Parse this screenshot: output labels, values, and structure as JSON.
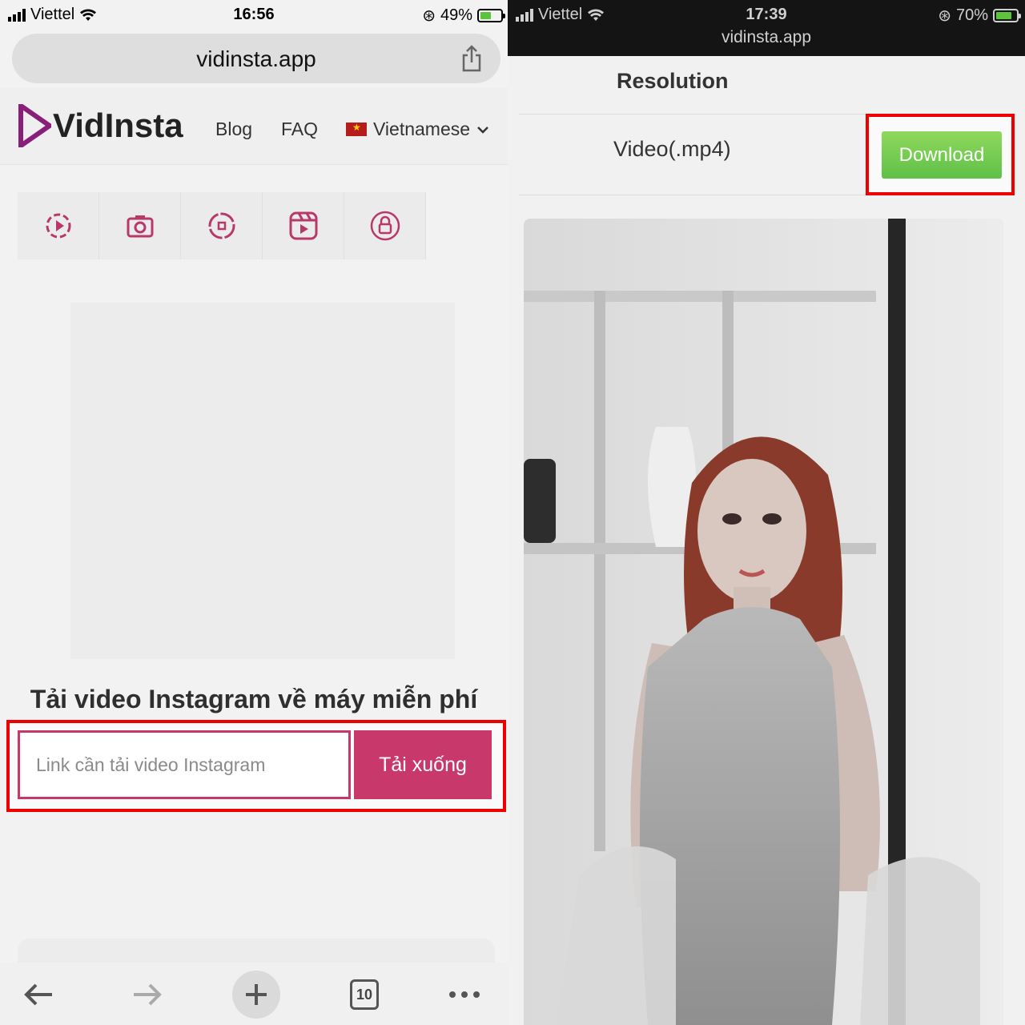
{
  "left": {
    "status": {
      "carrier": "Viettel",
      "time": "16:56",
      "battery": "49%"
    },
    "url": "vidinsta.app",
    "site": {
      "logo": "VidInsta",
      "nav": [
        "Blog",
        "FAQ"
      ],
      "language": "Vietnamese",
      "tab_icons": [
        "video-icon",
        "camera-icon",
        "story-icon",
        "reels-icon",
        "private-lock-icon"
      ]
    },
    "heading": "Tải video Instagram về máy miễn phí",
    "input_placeholder": "Link cần tải video Instagram",
    "submit_label": "Tải xuống",
    "toolbar": {
      "tabs_count": "10"
    }
  },
  "right": {
    "status": {
      "carrier": "Viettel",
      "time": "17:39",
      "battery": "70%",
      "domain": "vidinsta.app"
    },
    "resolution_label": "Resolution",
    "file_type": "Video(.mp4)",
    "download_label": "Download"
  },
  "colors": {
    "brand": "#c8386a",
    "highlight": "#ee0000",
    "download_green": "#6cc84e"
  }
}
